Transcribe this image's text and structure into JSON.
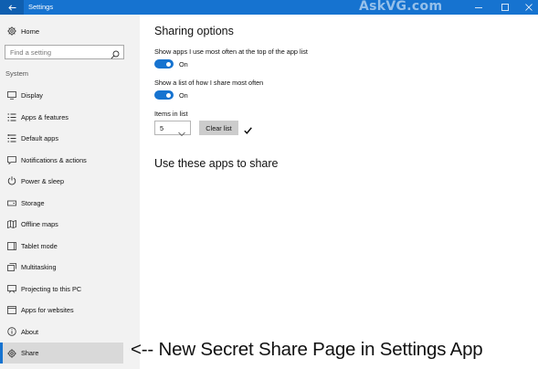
{
  "window": {
    "title": "Settings",
    "watermark": "AskVG.com",
    "accent_color": "#1673d0",
    "controls": [
      "minimize-icon",
      "maximize-icon",
      "close-icon"
    ]
  },
  "sidebar": {
    "home_label": "Home",
    "search": {
      "placeholder": "Find a setting",
      "icon": "search-icon"
    },
    "section_label": "System",
    "items": [
      {
        "label": "Display",
        "icon": "display-icon"
      },
      {
        "label": "Apps & features",
        "icon": "apps-list-icon"
      },
      {
        "label": "Default apps",
        "icon": "default-apps-icon"
      },
      {
        "label": "Notifications & actions",
        "icon": "notifications-icon"
      },
      {
        "label": "Power & sleep",
        "icon": "power-icon"
      },
      {
        "label": "Storage",
        "icon": "storage-icon"
      },
      {
        "label": "Offline maps",
        "icon": "map-icon"
      },
      {
        "label": "Tablet mode",
        "icon": "tablet-icon"
      },
      {
        "label": "Multitasking",
        "icon": "multitasking-icon"
      },
      {
        "label": "Projecting to this PC",
        "icon": "projecting-icon"
      },
      {
        "label": "Apps for websites",
        "icon": "websites-icon"
      },
      {
        "label": "About",
        "icon": "info-icon"
      },
      {
        "label": "Share",
        "icon": "share-icon",
        "selected": true
      }
    ]
  },
  "main": {
    "heading": "Sharing options",
    "setting1": {
      "label": "Show apps I use most often at the top of the app list",
      "state": "On"
    },
    "setting2": {
      "label": "Show a list of how I share most often",
      "state": "On"
    },
    "items_in_list": {
      "label": "Items in list",
      "value": "5"
    },
    "clear_button": "Clear list",
    "confirm_icon": "checkmark-icon",
    "subheading": "Use these apps to share"
  },
  "annotation": "<-- New Secret Share Page in Settings App"
}
